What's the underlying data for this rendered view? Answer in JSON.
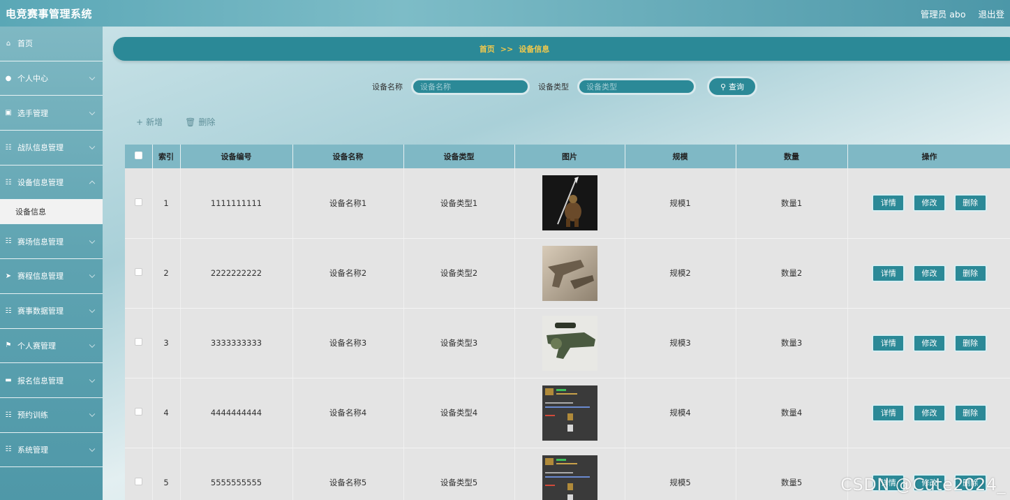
{
  "header": {
    "title": "电竞赛事管理系统",
    "user": "管理员 abo",
    "logout": "退出登"
  },
  "sidebar": {
    "items": [
      {
        "label": "首页",
        "icon": "home-icon"
      },
      {
        "label": "个人中心",
        "icon": "user-icon"
      },
      {
        "label": "选手管理",
        "icon": "clipboard-icon"
      },
      {
        "label": "战队信息管理",
        "icon": "grid-icon"
      },
      {
        "label": "设备信息管理",
        "icon": "grid-icon"
      },
      {
        "label": "赛场信息管理",
        "icon": "grid-icon"
      },
      {
        "label": "赛程信息管理",
        "icon": "send-icon"
      },
      {
        "label": "赛事数据管理",
        "icon": "grid-icon"
      },
      {
        "label": "个人赛管理",
        "icon": "flag-icon"
      },
      {
        "label": "报名信息管理",
        "icon": "printer-icon"
      },
      {
        "label": "预约训练",
        "icon": "grid-icon"
      },
      {
        "label": "系统管理",
        "icon": "grid-icon"
      }
    ],
    "active_sub": "设备信息"
  },
  "breadcrumb": {
    "home": "首页",
    "sep": ">>",
    "current": "设备信息"
  },
  "search": {
    "name_label": "设备名称",
    "name_placeholder": "设备名称",
    "type_label": "设备类型",
    "type_placeholder": "设备类型",
    "button": "查询"
  },
  "actions": {
    "add": "新增",
    "delete": "删除"
  },
  "table": {
    "columns": [
      "索引",
      "设备编号",
      "设备名称",
      "设备类型",
      "图片",
      "规模",
      "数量",
      "操作"
    ],
    "rows": [
      {
        "index": "1",
        "code": "1111111111",
        "name": "设备名称1",
        "type": "设备类型1",
        "scale": "规模1",
        "qty": "数量1"
      },
      {
        "index": "2",
        "code": "2222222222",
        "name": "设备名称2",
        "type": "设备类型2",
        "scale": "规模2",
        "qty": "数量2"
      },
      {
        "index": "3",
        "code": "3333333333",
        "name": "设备名称3",
        "type": "设备类型3",
        "scale": "规模3",
        "qty": "数量3"
      },
      {
        "index": "4",
        "code": "4444444444",
        "name": "设备名称4",
        "type": "设备类型4",
        "scale": "规模4",
        "qty": "数量4"
      },
      {
        "index": "5",
        "code": "5555555555",
        "name": "设备名称5",
        "type": "设备类型5",
        "scale": "规模5",
        "qty": "数量5"
      }
    ],
    "op_labels": {
      "detail": "详情",
      "edit": "修改",
      "delete": "删除"
    }
  },
  "watermark": "CSDN @Cute2024_",
  "colors": {
    "primary": "#2b8997",
    "accent": "#f2c94c",
    "header": "#5aa7b6"
  }
}
